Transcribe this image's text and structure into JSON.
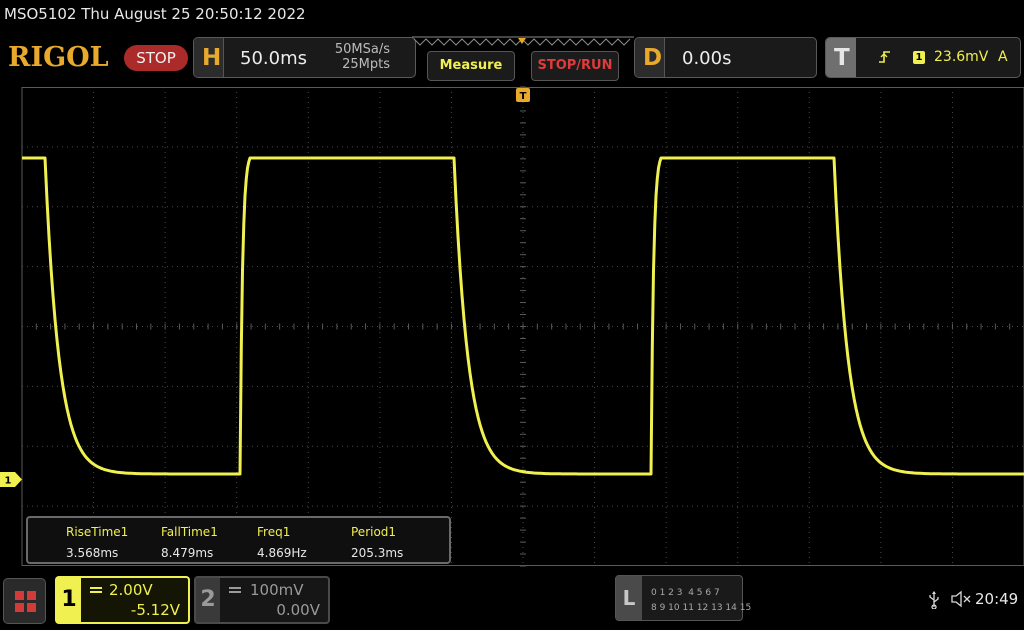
{
  "header": {
    "title": "MSO5102  Thu August 25 20:50:12 2022",
    "logo": "RIGOL",
    "run_state": "STOP"
  },
  "horizontal": {
    "letter": "H",
    "timebase": "50.0ms",
    "sample_rate": "50MSa/s",
    "memory_depth": "25Mpts"
  },
  "buttons": {
    "measure": "Measure",
    "stop_run": "STOP/RUN"
  },
  "delay": {
    "letter": "D",
    "value": "0.00s"
  },
  "trigger": {
    "letter": "T",
    "edge_icon": "rising-edge-icon",
    "source": "1",
    "level": "23.6mV",
    "mode": "A"
  },
  "ch1_marker": "1",
  "measurements": [
    {
      "name": "RiseTime1",
      "value": "3.568ms"
    },
    {
      "name": "FallTime1",
      "value": "8.479ms"
    },
    {
      "name": "Freq1",
      "value": "4.869Hz"
    },
    {
      "name": "Period1",
      "value": "205.3ms"
    }
  ],
  "channels": [
    {
      "num": "1",
      "scale": "2.00V",
      "offset": "-5.12V",
      "color": "#f0f050",
      "active": true
    },
    {
      "num": "2",
      "scale": "100mV",
      "offset": "0.00V",
      "color": "#9a9a9a",
      "active": false
    }
  ],
  "logic": {
    "letter": "L",
    "row1": "0 1 2 3  4 5 6 7",
    "row2": "8 9 10 11 12 13 14 15"
  },
  "status": {
    "usb_icon": "usb-icon",
    "speaker_icon": "speaker-muted-icon",
    "time": "20:49"
  },
  "colors": {
    "trace": "#f0f050",
    "accent": "#e8a92c",
    "stop": "#ab2a2a",
    "grid": "#4a4a4a"
  }
}
